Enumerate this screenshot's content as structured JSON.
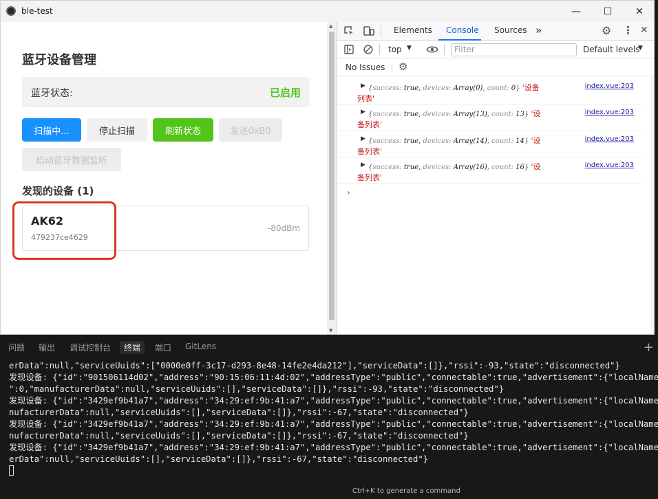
{
  "window": {
    "title": "ble-test",
    "minimize": "—",
    "maximize": "☐",
    "close": "✕"
  },
  "app": {
    "title": "蓝牙设备管理",
    "status_label": "蓝牙状态:",
    "status_value": "已启用",
    "buttons": {
      "scan": "扫描中...",
      "stop": "停止扫描",
      "refresh": "刷新状态",
      "send": "发送0xB0",
      "listen": "启动蓝牙数据监听"
    },
    "devices_heading": "发现的设备 (1)",
    "devices": [
      {
        "name": "AK62",
        "id": "479237ce4629",
        "rssi": "-80dBm"
      }
    ]
  },
  "devtools": {
    "tabs": [
      "Elements",
      "Console",
      "Sources"
    ],
    "active_tab": "Console",
    "more": "»",
    "context": "top",
    "filter_placeholder": "Filter",
    "levels": "Default levels",
    "issues": "No Issues",
    "logs": [
      {
        "count_arr": "Array(0)",
        "count": "0",
        "msg_head": "'设备",
        "msg_tail": "列表'",
        "source": "index.vue:203"
      },
      {
        "count_arr": "Array(13)",
        "count": "13",
        "msg_head": "'设",
        "msg_tail": "备列表'",
        "source": "index.vue:203"
      },
      {
        "count_arr": "Array(14)",
        "count": "14",
        "msg_head": "'设",
        "msg_tail": "备列表'",
        "source": "index.vue:203"
      },
      {
        "count_arr": "Array(16)",
        "count": "16",
        "msg_head": "'设",
        "msg_tail": "备列表'",
        "source": "index.vue:203"
      }
    ],
    "log_keys": {
      "success": "success:",
      "true_val": "true,",
      "devices": "devices:",
      "count": "count:"
    }
  },
  "terminal": {
    "tabs": [
      "问题",
      "输出",
      "调试控制台",
      "终端",
      "端口",
      "GitLens"
    ],
    "active_tab": "终端",
    "lines": [
      "erData\":null,\"serviceUuids\":[\"0000e0ff-3c17-d293-8e48-14fe2e4da212\"],\"serviceData\":[]},\"rssi\":-93,\"state\":\"disconnected\"}",
      "发现设备: {\"id\":\"901506114d02\",\"address\":\"90:15:06:11:4d:02\",\"addressType\":\"public\",\"connectable\":true,\"advertisement\":{\"localName\":\"T_",
      "\":0,\"manufacturerData\":null,\"serviceUuids\":[],\"serviceData\":[]},\"rssi\":-93,\"state\":\"disconnected\"}",
      "发现设备: {\"id\":\"3429ef9b41a7\",\"address\":\"34:29:ef:9b:41:a7\",\"addressType\":\"public\",\"connectable\":true,\"advertisement\":{\"localName\":\"U-",
      "nufacturerData\":null,\"serviceUuids\":[],\"serviceData\":[]},\"rssi\":-67,\"state\":\"disconnected\"}",
      "发现设备: {\"id\":\"3429ef9b41a7\",\"address\":\"34:29:ef:9b:41:a7\",\"addressType\":\"public\",\"connectable\":true,\"advertisement\":{\"localName\":\"U-",
      "nufacturerData\":null,\"serviceUuids\":[],\"serviceData\":[]},\"rssi\":-67,\"state\":\"disconnected\"}",
      "发现设备: {\"id\":\"3429ef9b41a7\",\"address\":\"34:29:ef:9b:41:a7\",\"addressType\":\"public\",\"connectable\":true,\"advertisement\":{\"localName\":\"\",",
      "erData\":null,\"serviceUuids\":[],\"serviceData\":[]},\"rssi\":-67,\"state\":\"disconnected\"}"
    ],
    "hint": "Ctrl+K to generate a command"
  }
}
